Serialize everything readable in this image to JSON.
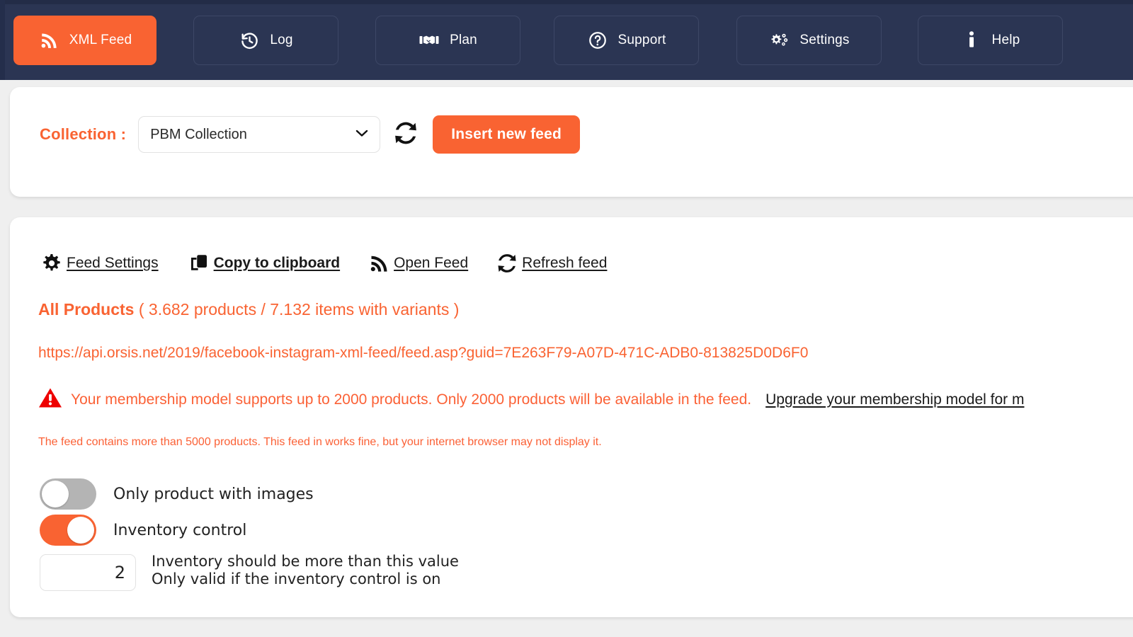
{
  "colors": {
    "accent": "#f96332",
    "navbar_bg": "#2b3553",
    "page_bg": "#efefef",
    "card_bg": "#ffffff",
    "warning_red": "#ee0000",
    "toggle_off": "#b4b4b4"
  },
  "navbar": {
    "items": [
      {
        "label": "XML Feed",
        "icon": "rss-icon",
        "active": true
      },
      {
        "label": "Log",
        "icon": "history-icon",
        "active": false
      },
      {
        "label": "Plan",
        "icon": "handshake-icon",
        "active": false
      },
      {
        "label": "Support",
        "icon": "question-circle-icon",
        "active": false
      },
      {
        "label": "Settings",
        "icon": "gears-icon",
        "active": false
      },
      {
        "label": "Help",
        "icon": "info-icon",
        "active": false
      }
    ]
  },
  "collection": {
    "label": "Collection :",
    "selected": "PBM Collection",
    "options": [
      "PBM Collection"
    ],
    "refresh_icon": "refresh-icon",
    "insert_button": "Insert new feed"
  },
  "feed": {
    "actions": [
      {
        "label": "Feed Settings",
        "icon": "gear-icon",
        "bold": false
      },
      {
        "label": "Copy to clipboard",
        "icon": "copy-icon",
        "bold": true
      },
      {
        "label": "Open Feed",
        "icon": "rss-icon",
        "bold": false
      },
      {
        "label": "Refresh feed",
        "icon": "refresh-icon",
        "bold": false
      }
    ],
    "products_title": "All Products",
    "products_counts": "( 3.682 products / 7.132 items with variants )",
    "url": "https://api.orsis.net/2019/facebook-instagram-xml-feed/feed.asp?guid=7E263F79-A07D-471C-ADB0-813825D0D6F0",
    "warning_icon": "warning-triangle-icon",
    "warning_text": "Your membership model supports up to 2000 products. Only 2000 products will be available in the feed.",
    "upgrade_link": "Upgrade your membership model for m",
    "note": "The feed contains more than 5000 products. This feed in works fine, but your internet browser may not display it.",
    "options": [
      {
        "label": "Only product with images",
        "state": "off"
      },
      {
        "label": "Inventory control",
        "state": "on"
      }
    ],
    "inventory_value": "2",
    "inventory_hint_line1": "Inventory should be more than this value",
    "inventory_hint_line2": "Only valid if the inventory control is on"
  }
}
